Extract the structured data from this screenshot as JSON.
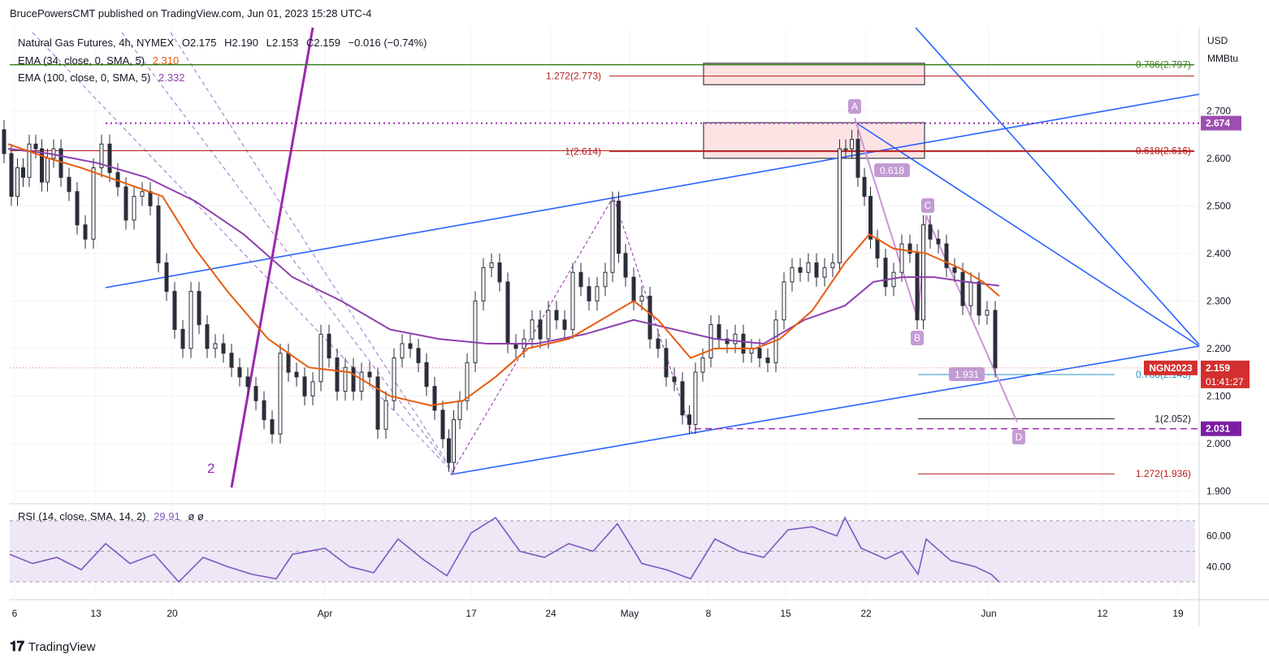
{
  "header": {
    "published": "BrucePowersCMT published on TradingView.com, Jun 01, 2023 15:28 UTC-4"
  },
  "legend": {
    "symbol_line": "Natural Gas Futures, 4h, NYMEX",
    "open": "O2.175",
    "high": "H2.190",
    "low": "L2.153",
    "close": "C2.159",
    "change": "−0.016 (−0.74%)",
    "ema34_label": "EMA (34, close, 0, SMA, 5)",
    "ema34_value": "2.310",
    "ema100_label": "EMA (100, close, 0, SMA, 5)",
    "ema100_value": "2.332"
  },
  "rsi_legend": {
    "label": "RSI (14, close, SMA, 14, 2)",
    "value": "29.91",
    "extra": "ø ø"
  },
  "footer": {
    "brand": "TradingView"
  },
  "colors": {
    "candle": "#2a2e39",
    "ema34": "#e65c0e",
    "ema100": "#8e3fae",
    "channel": "#2962ff",
    "green": "#3a7d1c",
    "red": "#b71c1c",
    "purple": "#9c27b0",
    "teal": "#2196c4",
    "zone": "#fde3e3",
    "rsi_bg": "#ede7f6",
    "rsi_line": "#7e57c2"
  },
  "chart_data": {
    "type": "candlestick",
    "title": "Natural Gas Futures, 4h, NYMEX",
    "currency": "USD",
    "unit": "MMBtu",
    "ylim": [
      1.88,
      2.875
    ],
    "y_ticks": [
      "2.700",
      "2.600",
      "2.500",
      "2.400",
      "2.300",
      "2.200",
      "2.100",
      "2.000",
      "1.900"
    ],
    "x_ticks": [
      "6",
      "13",
      "20",
      "Apr",
      "17",
      "24",
      "May",
      "8",
      "15",
      "22",
      "Jun",
      "12",
      "19"
    ],
    "price_path": [
      [
        0,
        2.66
      ],
      [
        10,
        2.61
      ],
      [
        18,
        2.52
      ],
      [
        25,
        2.58
      ],
      [
        32,
        2.56
      ],
      [
        40,
        2.63
      ],
      [
        48,
        2.62
      ],
      [
        55,
        2.55
      ],
      [
        62,
        2.6
      ],
      [
        70,
        2.62
      ],
      [
        80,
        2.56
      ],
      [
        90,
        2.53
      ],
      [
        100,
        2.46
      ],
      [
        110,
        2.43
      ],
      [
        120,
        2.58
      ],
      [
        130,
        2.63
      ],
      [
        140,
        2.57
      ],
      [
        150,
        2.54
      ],
      [
        160,
        2.47
      ],
      [
        170,
        2.52
      ],
      [
        180,
        2.53
      ],
      [
        190,
        2.5
      ],
      [
        200,
        2.38
      ],
      [
        210,
        2.32
      ],
      [
        220,
        2.24
      ],
      [
        230,
        2.2
      ],
      [
        240,
        2.32
      ],
      [
        250,
        2.25
      ],
      [
        260,
        2.2
      ],
      [
        270,
        2.21
      ],
      [
        280,
        2.19
      ],
      [
        290,
        2.16
      ],
      [
        300,
        2.14
      ],
      [
        310,
        2.12
      ],
      [
        320,
        2.09
      ],
      [
        330,
        2.05
      ],
      [
        340,
        2.02
      ],
      [
        350,
        2.19
      ],
      [
        360,
        2.15
      ],
      [
        370,
        2.14
      ],
      [
        380,
        2.1
      ],
      [
        390,
        2.13
      ],
      [
        400,
        2.23
      ],
      [
        410,
        2.18
      ],
      [
        420,
        2.11
      ],
      [
        430,
        2.16
      ],
      [
        440,
        2.11
      ],
      [
        450,
        2.15
      ],
      [
        460,
        2.14
      ],
      [
        470,
        2.03
      ],
      [
        480,
        2.09
      ],
      [
        490,
        2.18
      ],
      [
        500,
        2.21
      ],
      [
        510,
        2.2
      ],
      [
        520,
        2.17
      ],
      [
        530,
        2.12
      ],
      [
        540,
        2.07
      ],
      [
        550,
        2.01
      ],
      [
        555,
        1.96
      ],
      [
        562,
        2.05
      ],
      [
        570,
        2.09
      ],
      [
        580,
        2.17
      ],
      [
        590,
        2.3
      ],
      [
        600,
        2.37
      ],
      [
        610,
        2.38
      ],
      [
        620,
        2.34
      ],
      [
        630,
        2.21
      ],
      [
        640,
        2.2
      ],
      [
        650,
        2.22
      ],
      [
        660,
        2.26
      ],
      [
        670,
        2.22
      ],
      [
        680,
        2.28
      ],
      [
        690,
        2.26
      ],
      [
        700,
        2.24
      ],
      [
        710,
        2.36
      ],
      [
        720,
        2.33
      ],
      [
        730,
        2.3
      ],
      [
        740,
        2.33
      ],
      [
        750,
        2.36
      ],
      [
        758,
        2.51
      ],
      [
        765,
        2.4
      ],
      [
        775,
        2.35
      ],
      [
        785,
        2.3
      ],
      [
        795,
        2.31
      ],
      [
        805,
        2.22
      ],
      [
        815,
        2.2
      ],
      [
        825,
        2.14
      ],
      [
        835,
        2.13
      ],
      [
        845,
        2.06
      ],
      [
        852,
        2.04
      ],
      [
        860,
        2.15
      ],
      [
        870,
        2.18
      ],
      [
        880,
        2.25
      ],
      [
        890,
        2.22
      ],
      [
        900,
        2.21
      ],
      [
        910,
        2.23
      ],
      [
        920,
        2.19
      ],
      [
        930,
        2.2
      ],
      [
        940,
        2.18
      ],
      [
        950,
        2.17
      ],
      [
        960,
        2.26
      ],
      [
        970,
        2.34
      ],
      [
        980,
        2.37
      ],
      [
        990,
        2.36
      ],
      [
        1000,
        2.38
      ],
      [
        1010,
        2.35
      ],
      [
        1020,
        2.37
      ],
      [
        1030,
        2.38
      ],
      [
        1037,
        2.62
      ],
      [
        1045,
        2.62
      ],
      [
        1052,
        2.64
      ],
      [
        1060,
        2.56
      ],
      [
        1068,
        2.52
      ],
      [
        1075,
        2.43
      ],
      [
        1085,
        2.39
      ],
      [
        1095,
        2.33
      ],
      [
        1105,
        2.36
      ],
      [
        1115,
        2.42
      ],
      [
        1125,
        2.4
      ],
      [
        1133,
        2.26
      ],
      [
        1140,
        2.46
      ],
      [
        1150,
        2.43
      ],
      [
        1160,
        2.42
      ],
      [
        1170,
        2.37
      ],
      [
        1180,
        2.36
      ],
      [
        1190,
        2.29
      ],
      [
        1200,
        2.34
      ],
      [
        1210,
        2.27
      ],
      [
        1220,
        2.28
      ],
      [
        1230,
        2.159
      ]
    ],
    "ema34_path": [
      [
        10,
        2.63
      ],
      [
        60,
        2.6
      ],
      [
        100,
        2.58
      ],
      [
        150,
        2.55
      ],
      [
        200,
        2.52
      ],
      [
        240,
        2.41
      ],
      [
        280,
        2.32
      ],
      [
        330,
        2.22
      ],
      [
        380,
        2.16
      ],
      [
        430,
        2.15
      ],
      [
        480,
        2.1
      ],
      [
        530,
        2.08
      ],
      [
        570,
        2.09
      ],
      [
        610,
        2.14
      ],
      [
        650,
        2.2
      ],
      [
        700,
        2.22
      ],
      [
        740,
        2.26
      ],
      [
        780,
        2.3
      ],
      [
        810,
        2.26
      ],
      [
        850,
        2.18
      ],
      [
        880,
        2.2
      ],
      [
        930,
        2.2
      ],
      [
        960,
        2.22
      ],
      [
        1000,
        2.28
      ],
      [
        1040,
        2.38
      ],
      [
        1070,
        2.44
      ],
      [
        1100,
        2.41
      ],
      [
        1140,
        2.4
      ],
      [
        1180,
        2.37
      ],
      [
        1210,
        2.34
      ],
      [
        1230,
        2.31
      ]
    ],
    "ema100_path": [
      [
        10,
        2.62
      ],
      [
        60,
        2.61
      ],
      [
        120,
        2.59
      ],
      [
        180,
        2.56
      ],
      [
        240,
        2.51
      ],
      [
        300,
        2.44
      ],
      [
        360,
        2.35
      ],
      [
        420,
        2.3
      ],
      [
        480,
        2.24
      ],
      [
        540,
        2.22
      ],
      [
        600,
        2.21
      ],
      [
        660,
        2.21
      ],
      [
        720,
        2.23
      ],
      [
        780,
        2.26
      ],
      [
        830,
        2.24
      ],
      [
        880,
        2.22
      ],
      [
        940,
        2.21
      ],
      [
        990,
        2.26
      ],
      [
        1040,
        2.29
      ],
      [
        1075,
        2.34
      ],
      [
        1110,
        2.35
      ],
      [
        1150,
        2.35
      ],
      [
        1190,
        2.34
      ],
      [
        1230,
        2.332
      ]
    ],
    "rsi": {
      "ylim": [
        20,
        80
      ],
      "y_ticks": [
        "60.00",
        "40.00"
      ],
      "bands": [
        70,
        50,
        30
      ],
      "path": [
        [
          12,
          48
        ],
        [
          40,
          42
        ],
        [
          70,
          46
        ],
        [
          100,
          38
        ],
        [
          130,
          55
        ],
        [
          160,
          42
        ],
        [
          190,
          48
        ],
        [
          220,
          30
        ],
        [
          250,
          46
        ],
        [
          280,
          40
        ],
        [
          310,
          35
        ],
        [
          340,
          32
        ],
        [
          360,
          48
        ],
        [
          400,
          52
        ],
        [
          430,
          40
        ],
        [
          460,
          36
        ],
        [
          490,
          58
        ],
        [
          520,
          45
        ],
        [
          550,
          34
        ],
        [
          580,
          62
        ],
        [
          610,
          72
        ],
        [
          640,
          50
        ],
        [
          670,
          46
        ],
        [
          700,
          55
        ],
        [
          730,
          50
        ],
        [
          760,
          68
        ],
        [
          790,
          42
        ],
        [
          820,
          38
        ],
        [
          850,
          32
        ],
        [
          880,
          58
        ],
        [
          910,
          50
        ],
        [
          940,
          46
        ],
        [
          970,
          64
        ],
        [
          1000,
          66
        ],
        [
          1030,
          60
        ],
        [
          1040,
          72
        ],
        [
          1060,
          52
        ],
        [
          1090,
          45
        ],
        [
          1110,
          50
        ],
        [
          1130,
          35
        ],
        [
          1140,
          58
        ],
        [
          1170,
          44
        ],
        [
          1200,
          40
        ],
        [
          1220,
          35
        ],
        [
          1230,
          29.91
        ]
      ]
    },
    "horizontal_levels": [
      {
        "label": "0.786(2.797)",
        "value": 2.797,
        "color_key": "green",
        "label_side": "right"
      },
      {
        "label": "1.272(2.773)",
        "value": 2.773,
        "color_key": "red",
        "label_side": "left"
      },
      {
        "label": "1(2.614)",
        "value": 2.614,
        "color_key": "red",
        "label_side": "left"
      },
      {
        "label": "0.618(2.616)",
        "value": 2.616,
        "color_key": "red",
        "label_side": "right"
      },
      {
        "label": "0.786(2.145)",
        "value": 2.145,
        "color_key": "teal",
        "label_side": "right"
      },
      {
        "label": "1(2.052)",
        "value": 2.052,
        "color_key": "black",
        "label_side": "right"
      },
      {
        "label": "1.272(1.936)",
        "value": 1.936,
        "color_key": "red",
        "label_side": "right"
      }
    ],
    "dotted_level": {
      "value": 2.674,
      "label": "2.674"
    },
    "dashed_level": {
      "value": 2.031,
      "label": "2.031"
    },
    "current_price": {
      "symbol": "NGN2023",
      "value": "2.159",
      "countdown": "01:41:27"
    },
    "zones": [
      {
        "top": 2.8,
        "bottom": 2.755
      },
      {
        "top": 2.675,
        "bottom": 2.6
      }
    ],
    "pattern_points": [
      "A",
      "B",
      "C",
      "D"
    ],
    "pattern_ratios": [
      "0.618",
      "1.931"
    ],
    "wave_label": "2"
  }
}
